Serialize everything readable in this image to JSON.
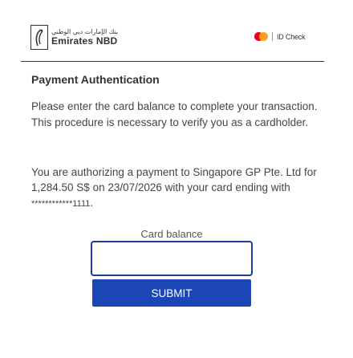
{
  "header": {
    "bank_name_arabic": "بنك الإمارات دبي الوطني",
    "bank_name": "Emirates NBD",
    "bank_icon": "emirates-nbd-emblem",
    "scheme_icon": "mastercard-logo",
    "scheme_label": "ID Check",
    "colors": {
      "mc_red": "#eb001b",
      "mc_orange": "#f79e1b"
    }
  },
  "main": {
    "title": "Payment Authentication",
    "instruction": "Please enter the card balance to complete your transaction. This procedure is necessary to verify you as a cardholder.",
    "auth_prefix": "You are authorizing a payment to Singapore GP Pte. Ltd for 1,284.50 S$ on 23/07/2026 with your card ending with ",
    "masked_card": "************1111",
    "auth_suffix": "."
  },
  "form": {
    "balance_label": "Card balance",
    "balance_value": "",
    "submit_label": "SUBMIT",
    "colors": {
      "input_border": "#1d3f9c",
      "button_bg": "#1c45b6"
    }
  }
}
